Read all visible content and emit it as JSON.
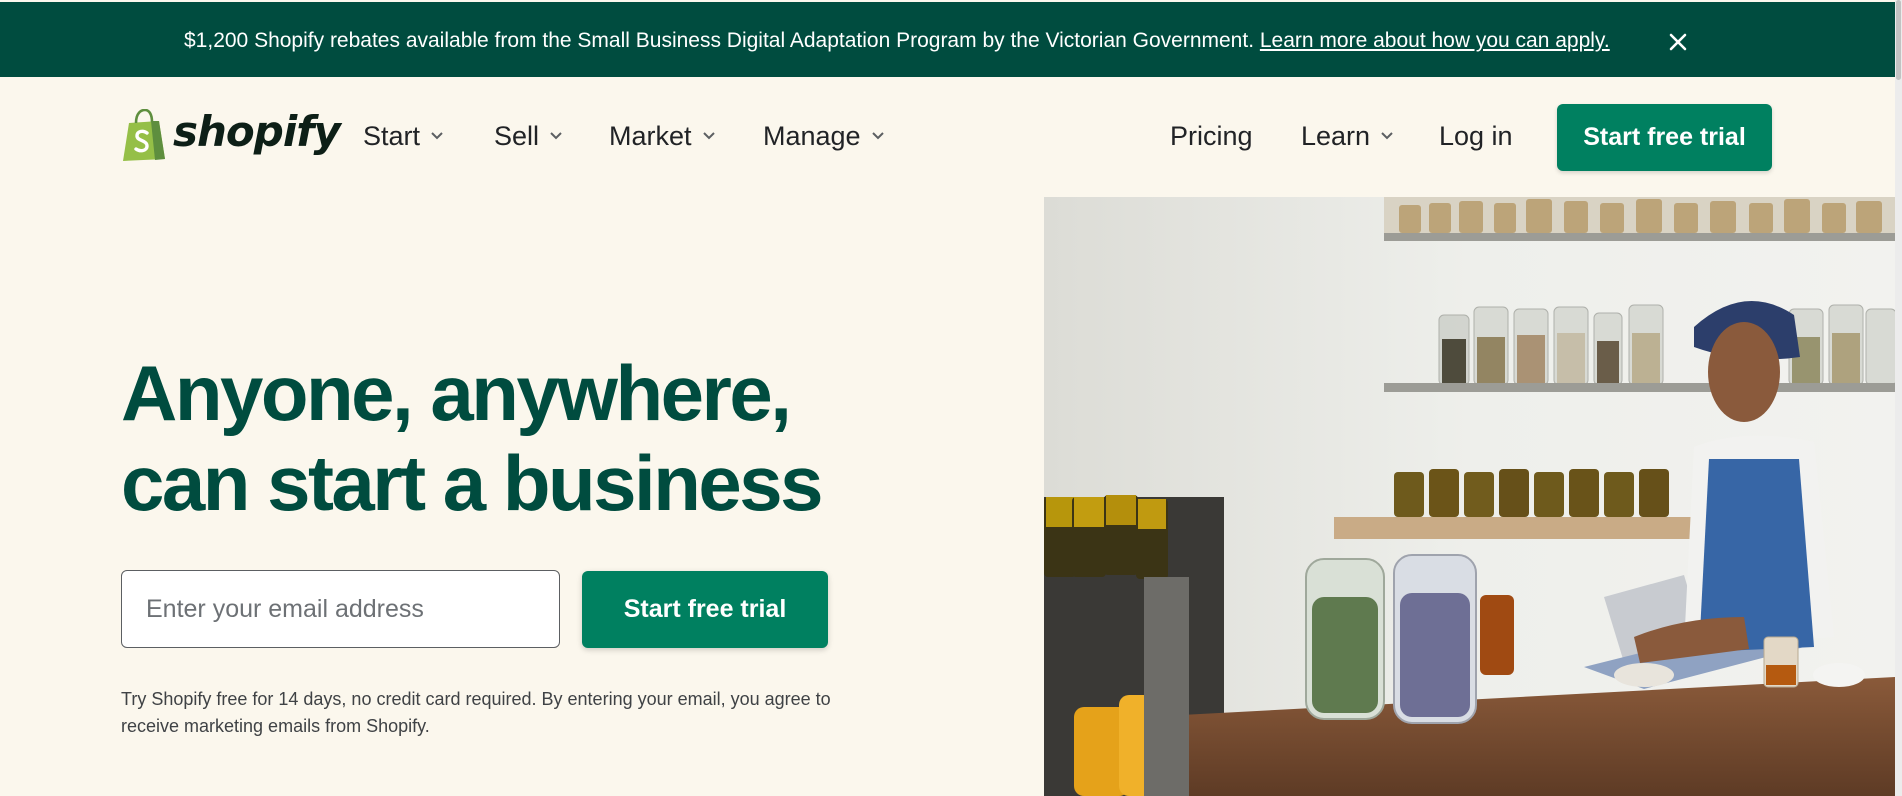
{
  "banner": {
    "message": "$1,200 Shopify rebates available from the Small Business Digital Adaptation Program by the Victorian Government.",
    "link": "Learn more about how you can apply.",
    "close_icon": "close-icon"
  },
  "nav": {
    "logo": {
      "icon": "shopping-bag-icon",
      "word": "shopify"
    },
    "left_items": [
      {
        "label": "Start",
        "has_dropdown": true
      },
      {
        "label": "Sell",
        "has_dropdown": true
      },
      {
        "label": "Market",
        "has_dropdown": true
      },
      {
        "label": "Manage",
        "has_dropdown": true
      }
    ],
    "right_items": [
      {
        "label": "Pricing",
        "has_dropdown": false
      },
      {
        "label": "Learn",
        "has_dropdown": true
      },
      {
        "label": "Log in",
        "has_dropdown": false
      }
    ],
    "cta_label": "Start free trial"
  },
  "hero": {
    "headline_line1": "Anyone, anywhere,",
    "headline_line2": "can start a business",
    "email_placeholder": "Enter your email address",
    "email_value": "",
    "cta_label": "Start free trial",
    "disclaimer": "Try Shopify free for 14 days, no credit card required. By entering your email, you agree to receive marketing emails from Shopify."
  },
  "colors": {
    "banner_bg": "#004c3f",
    "page_bg": "#fbf7ed",
    "headline": "#004c3f",
    "accent": "#008060",
    "logo_green": "#95bf47"
  }
}
